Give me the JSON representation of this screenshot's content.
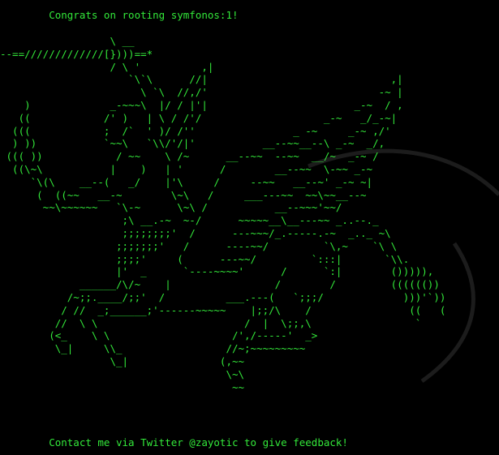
{
  "terminal": {
    "congrats": "        Congrats on rooting symfonos:1!",
    "ascii_art": [
      "                  \\ __",
      "--==/////////////[})))==*",
      "                  / \\ '          ,|",
      "                     `\\`\\      //|                              ,|",
      "                       \\ `\\  //,/'                            -~ |",
      "    )             _-~~~\\  |/ / |'|                        _-~  / ,",
      "   ((            /' )   | \\ / /'/                    _-~   _/_-~|",
      "  (((            ;  /`  ' )/ /''                _ -~     _-~ ,/'",
      "  ) ))           `~~\\   `\\\\/'/|'           __--~~__--\\ _-~  _/,",
      " ((( ))            / ~~    \\ /~      __--~~  --~~  __/~  _-~ /",
      "  ((\\~\\           |    )   | '      /        __--~~  \\-~~ _-~",
      "     `\\(\\    __--(   _/    |'\\     /     --~~   __--~' _-~ ~|",
      "      (  ((~~   __-~        \\~\\   /     ___---~~  ~~\\~~__--~",
      "       ~~\\~~~~~~   `\\-~      \\~\\ /           __--~~~'~~/",
      "                    ;\\ __.-~  ~-/      ~~~~~__\\__---~~ _..--._",
      "                    ;;;;;;;;'  /      ---~~~/_.-----.-~  _.._ ~\\",
      "                   ;;;;;;;'   /      ----~~/         `\\,~    `\\ \\",
      "                   ;;;;'     (      ---~~/         `:::|       `\\\\.",
      "                   |'  _      `----~~~~'      /      `:|        ())))),",
      "             ______/\\/~    |                 /        /         (((((())",
      "           /~;;.____/;;'  /          ___.---(   `;;;/             )))'`))",
      "          / //  _;______;'------~~~~~    |;;/\\    /                ((   (",
      "         //  \\ \\                        /  |  \\;;,\\                 `",
      "        (<_    \\ \\                    /',/-----'  _>",
      "         \\_|     \\\\_                 //~;~~~~~~~~~",
      "                  \\_|               (,~~",
      "                                     \\~\\",
      "                                      ~~"
    ],
    "contact": "        Contact me via Twitter @zayotic to give feedback!"
  },
  "colors": {
    "background": "#000000",
    "text": "#33e83a",
    "swirl": "#1c1c1c"
  }
}
